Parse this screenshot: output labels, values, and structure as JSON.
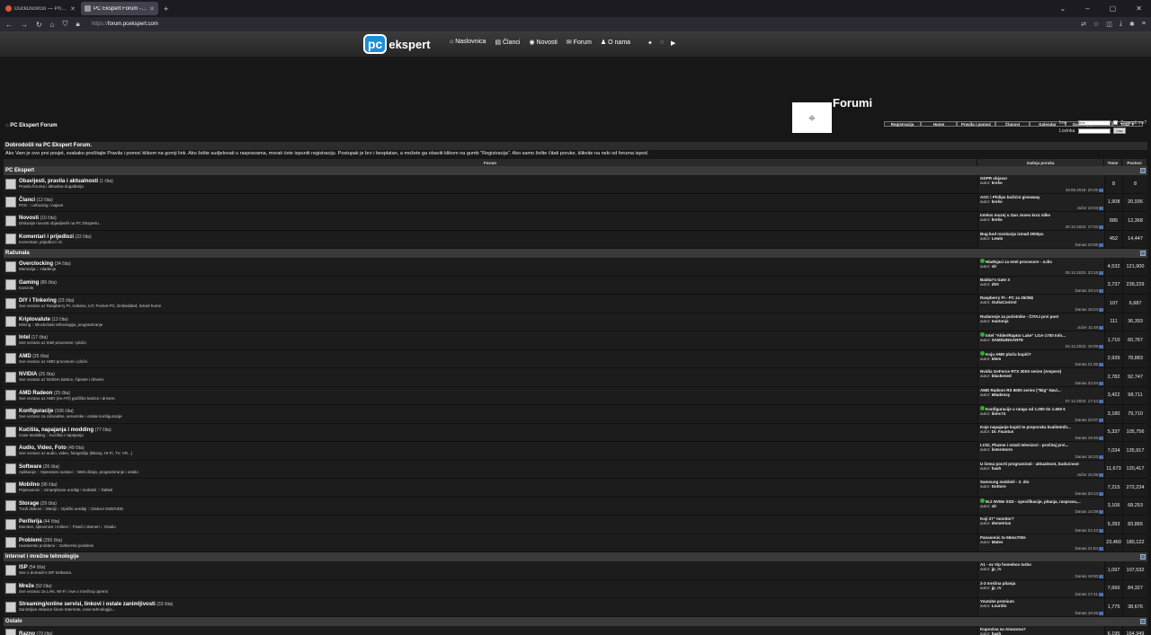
{
  "browser": {
    "tabs": [
      {
        "label": "DuckDuckGo — Privacy, simplif",
        "color": "#de5833",
        "active": false
      },
      {
        "label": "PC Ekspert Forum - Podupire vi",
        "color": "#999999",
        "active": true
      }
    ],
    "url_prefix": "https://",
    "url_domain": "forum.",
    "url_host": "pcekspert.com"
  },
  "site": {
    "logo_pc": "pc",
    "logo_rest": "ekspert",
    "nav": [
      "Naslovnica",
      "Članci",
      "Novosti",
      "Forum",
      "O nama"
    ],
    "nav_icons": [
      "home-icon",
      "articles-icon",
      "news-icon",
      "forum-icon",
      "user-icon"
    ],
    "forum_title": "Forumi",
    "forum_nav": [
      "Registracija",
      "Home",
      "Pravila i pomoć",
      "Članovi",
      "Kalendar",
      "Današnji postovi",
      "Traži ▼"
    ],
    "breadcrumb": "PC Ekspert Forum",
    "login": {
      "user_label": "Ime",
      "user_value": "Ime",
      "remember": "Zapamti me?",
      "pass_label": "Lozinka",
      "button": "Ulaz"
    },
    "welcome_title": "Dobrodošli na PC Ekspert Forum.",
    "welcome_text": "Ako Vam je ovo prvi posjet, svakako pročitajte Pravila i pomoć klikom na gornji link. Ako želite sudjelovati u raspravama, morati ćete ispuniti registraciju. Postupak je brz i besplatan, a možete ga obaviti klikom na gumb \"Registracija\". Ako samo želite čitati poruke, kliknite na neki od foruma ispod."
  },
  "table": {
    "headers": {
      "forum": "Forum",
      "last": "Zadnja poruka",
      "topics": "Teme",
      "posts": "Postovi"
    },
    "categories": [
      {
        "name": "PC Ekspert",
        "forums": [
          {
            "name": "Obavijesti, pravila i aktualnosti",
            "count": "(1 čita)",
            "desc": "Pravila foruma i aktualna događanja",
            "last_title": "GDPR objava!",
            "new": false,
            "author": "krešo",
            "date": "19.06.2018. 20:25",
            "topics": "8",
            "posts": "8"
          },
          {
            "name": "Članci",
            "count": "(12 čita)",
            "desc": "PCE :: unboxing i najave",
            "last_title": "AOC i Philips božićni giveaway",
            "new": false,
            "author": "krešo",
            "date": "Jučer 23:03",
            "topics": "1,908",
            "posts": "20,936"
          },
          {
            "name": "Novosti",
            "count": "(10 čita)",
            "desc": "Diskusije novosti objavljenih na PC Ekspertu.",
            "last_title": "Intelov muzej u San Joseu kroz slike",
            "new": false,
            "author": "krešo",
            "date": "20.10.2023. 17:03",
            "topics": "885",
            "posts": "12,368"
          },
          {
            "name": "Komentari i prijedlozi",
            "count": "(22 čita)",
            "desc": "Komentari, prijedlozi i sl.",
            "last_title": "Bug kod rezolucija izmađ 2000px",
            "new": false,
            "author": "Lewis",
            "date": "Danas 23:06",
            "topics": "452",
            "posts": "14,447"
          }
        ]
      },
      {
        "name": "Računala",
        "forums": [
          {
            "name": "Overclocking",
            "count": "(34 čita)",
            "desc": "Memorija :: Hlađenje",
            "last_title": "Hlađnjaci za Intel procesore - 4.dio",
            "new": true,
            "author": "xlr",
            "date": "05.12.2023. 23:15",
            "topics": "4,532",
            "posts": "121,900"
          },
          {
            "name": "Gaming",
            "count": "(86 čita)",
            "desc": "Konzole",
            "last_title": "Baldur's Gate 3",
            "new": false,
            "author": "d0X",
            "date": "Danas 19:14",
            "topics": "3,737",
            "posts": "239,229"
          },
          {
            "name": "DIY i Tinkering",
            "count": "(23 čita)",
            "desc": "Sve vezano uz Raspberry Pi, Arduino, IoT, Pocket PC, Embedded, Smart home",
            "last_title": "Raspberry Pi - PC za 25/35$",
            "new": false,
            "author": "OuttaControl",
            "date": "Danas 18:24",
            "topics": "107",
            "posts": "6,687"
          },
          {
            "name": "Kriptovalute",
            "count": "(12 čita)",
            "desc": "Mining :: Blockchain tehnologija, programiranje",
            "last_title": "Rudarenje za početnike - ČITAJ prvi post",
            "new": false,
            "author": "maXonja",
            "date": "Jučer 11:48",
            "topics": "111",
            "posts": "36,393"
          },
          {
            "name": "Intel",
            "count": "(17 čita)",
            "desc": "Sve vezano uz Intel procesore i ploče.",
            "last_title": "Intel \"Alder/Raptor Lake\" LGA-1700 Info...",
            "new": true,
            "author": "SAMSUNGANTE",
            "date": "04.12.2023. 15:09",
            "topics": "1,710",
            "posts": "60,767"
          },
          {
            "name": "AMD",
            "count": "(25 čita)",
            "desc": "Sve vezano uz AMD procesore i ploče.",
            "last_title": "Koju AMD ploču kupiti?",
            "new": true,
            "author": "Idem",
            "date": "Danas 21:35",
            "topics": "2,939",
            "posts": "78,883"
          },
          {
            "name": "NVIDIA",
            "count": "(25 čita)",
            "desc": "Sve vezano uz NVIDIA kartice, čipsete i drivere.",
            "last_title": "Nvidia GeForce RTX 30X0 series (Ampere)",
            "new": false,
            "author": "blackened",
            "date": "Danas 23:34",
            "topics": "2,782",
            "posts": "92,747"
          },
          {
            "name": "AMD Radeon",
            "count": "(25 čita)",
            "desc": "Sve vezano uz AMD (ex-ATI) grafičke kartice i drivere.",
            "last_title": "AMD Radeon RX 6000 series (\"Big\" Navi...",
            "new": false,
            "author": "Mladenxy",
            "date": "07.12.2023. 17:44",
            "topics": "3,422",
            "posts": "98,711"
          },
          {
            "name": "Konfiguracije",
            "count": "(106 čita)",
            "desc": "Sve vezano za računalne, serverske i ostale konfiguracije",
            "last_title": "Konfiguracije u rangu od 1.000 do 1.500 €",
            "new": true,
            "author": "ibmc74",
            "date": "Danas 22:07",
            "topics": "3,180",
            "posts": "79,710"
          },
          {
            "name": "Kućišta, napajanja i modding",
            "count": "(77 čita)",
            "desc": "Case Modding :: Kućišta i napajanja",
            "last_title": "Koje napajanje kupiti te preporuka kvalitetnih...",
            "new": false,
            "author": "Dr. Faustus",
            "date": "Danas 19:46",
            "topics": "5,337",
            "posts": "105,756"
          },
          {
            "name": "Audio, Video, Foto",
            "count": "(49 čita)",
            "desc": "Sve vezano uz audio, video, fotografiju (Bluray, Hi-Fi, TV, VR...)",
            "last_title": "LCDi, Plazme i ostali televizori - pročitaj prvi...",
            "new": false,
            "author": "listerstorm",
            "date": "Danas 18:23",
            "topics": "7,034",
            "posts": "135,917"
          },
          {
            "name": "Software",
            "count": "(26 čita)",
            "desc": "Aplikacije :: Operativni sustavi :: Web dizajn, programiranje i ostalo",
            "last_title": "U čemu pocrti programirati - aktualnost, budućnost",
            "new": false,
            "author": "hash",
            "date": "Jučer 16:39",
            "topics": "11,673",
            "posts": "120,417"
          },
          {
            "name": "Mobilno",
            "count": "(96 čita)",
            "desc": "Prijenosnici :: Smartphone uređaji i mobiteli :: Tableti",
            "last_title": "Samsung mobiteli - 2. dio",
            "new": false,
            "author": "Dottore",
            "date": "Danas 20:13",
            "topics": "7,215",
            "posts": "272,234"
          },
          {
            "name": "Storage",
            "count": "(29 čita)",
            "desc": "Tvrdi diskovi :: Mediji :: Optički uređaji :: Diskovi SSD/HDD",
            "last_title": "M.2 NVMe SSD - specifikacije, pitanja, rasprava,...",
            "new": true,
            "author": "xlr",
            "date": "Danas 14:39",
            "topics": "3,106",
            "posts": "68,253"
          },
          {
            "name": "Periferija",
            "count": "(44 čita)",
            "desc": "Monitori, tipkovnice i miševi :: Pisači i skeneri :: Ostalo",
            "last_title": "Koji 27\" monitor?",
            "new": false,
            "author": "demetrius",
            "date": "Danas 21:43",
            "topics": "5,283",
            "posts": "83,865"
          },
          {
            "name": "Problemi",
            "count": "(250 čita)",
            "desc": "Hardverski problemi :: Softverski problemi",
            "last_title": "Panasonic tx-55mx700e",
            "new": false,
            "author": "Matex",
            "date": "Danas 21:54",
            "topics": "23,460",
            "posts": "180,122"
          }
        ]
      },
      {
        "name": "Internet i mrežne tehnologije",
        "forums": [
          {
            "name": "ISP",
            "count": "(54 čita)",
            "desc": "Sve o domaćim ISP tvrtkama.",
            "last_title": "A1 - ex Vip homebox turbo",
            "new": false,
            "author": "jp_rv",
            "date": "Danas 19:50",
            "topics": "1,097",
            "posts": "107,532"
          },
          {
            "name": "Mreže",
            "count": "(52 čita)",
            "desc": "Sve vezano za LAN, Wi-Fi i sve o mrežnoj opremi",
            "last_title": "2-3 mrežna pitanja",
            "new": false,
            "author": "jp_rv",
            "date": "Danas 17:41",
            "topics": "7,666",
            "posts": "84,327"
          },
          {
            "name": "Streaming/online servisi, linkovi i ostale zanimljivosti",
            "count": "(33 čita)",
            "desc": "Zanimljive stranice širom Interneta, nove tehnologije...",
            "last_title": "Youtube premium",
            "new": false,
            "author": "Lourdin",
            "date": "Danas 18:46",
            "topics": "1,775",
            "posts": "38,676"
          }
        ]
      },
      {
        "name": "Ostalo",
        "forums": [
          {
            "name": "Razno",
            "count": "(79 čita)",
            "desc": "",
            "last_title": "Kupovina sa Amazona?",
            "new": false,
            "author": "hash",
            "date": "",
            "topics": "6,195",
            "posts": "164,949"
          }
        ]
      }
    ]
  },
  "labels": {
    "author_prefix": "autor: "
  }
}
